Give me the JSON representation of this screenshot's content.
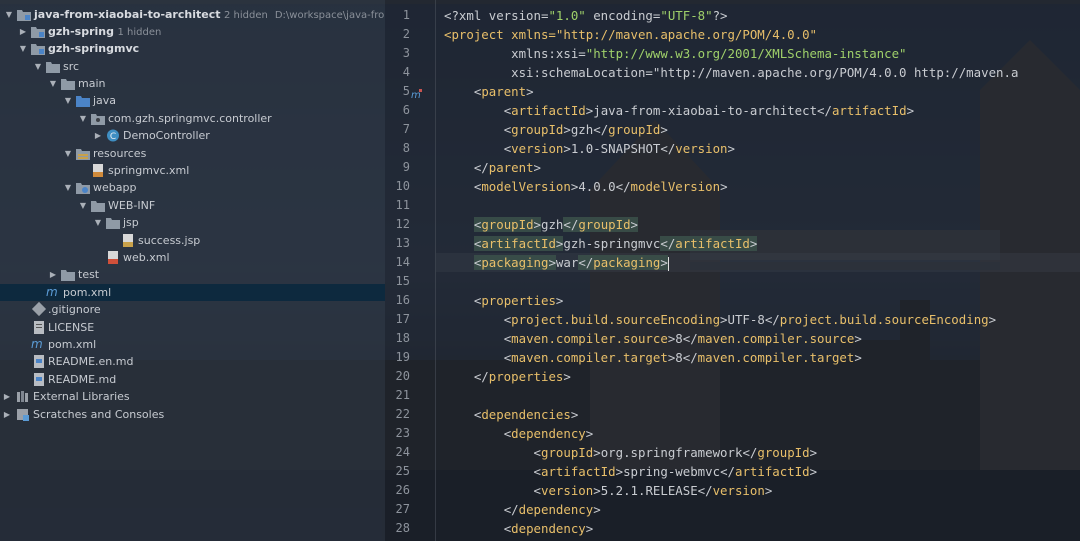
{
  "project_tree": {
    "items": [
      {
        "label": "java-from-xiaobai-to-architect",
        "hidden": "2 hidden",
        "path": "D:\\workspace\\java-from-xiaoba",
        "type": "module",
        "expanded": true
      },
      {
        "label": "gzh-spring",
        "hidden": "1 hidden",
        "type": "module",
        "expanded": false
      },
      {
        "label": "gzh-springmvc",
        "type": "module",
        "expanded": true
      },
      {
        "label": "src",
        "type": "folder",
        "expanded": true
      },
      {
        "label": "main",
        "type": "folder",
        "expanded": true
      },
      {
        "label": "java",
        "type": "source-folder",
        "expanded": true
      },
      {
        "label": "com.gzh.springmvc.controller",
        "type": "package",
        "expanded": true
      },
      {
        "label": "DemoController",
        "type": "class",
        "expanded": false
      },
      {
        "label": "resources",
        "type": "resources-folder",
        "expanded": true
      },
      {
        "label": "springmvc.xml",
        "type": "xml-file"
      },
      {
        "label": "webapp",
        "type": "web-folder",
        "expanded": true
      },
      {
        "label": "WEB-INF",
        "type": "folder",
        "expanded": true
      },
      {
        "label": "jsp",
        "type": "folder",
        "expanded": true
      },
      {
        "label": "success.jsp",
        "type": "jsp-file"
      },
      {
        "label": "web.xml",
        "type": "xml-file"
      },
      {
        "label": "test",
        "type": "folder",
        "expanded": false
      },
      {
        "label": "pom.xml",
        "type": "maven-file",
        "selected": true
      },
      {
        "label": ".gitignore",
        "type": "git-file"
      },
      {
        "label": "LICENSE",
        "type": "text-file"
      },
      {
        "label": "pom.xml",
        "type": "maven-file"
      },
      {
        "label": "README.en.md",
        "type": "md-file"
      },
      {
        "label": "README.md",
        "type": "md-file"
      },
      {
        "label": "External Libraries",
        "type": "libraries",
        "expanded": false
      },
      {
        "label": "Scratches and Consoles",
        "type": "scratches",
        "expanded": false
      }
    ]
  },
  "editor": {
    "file": "pom.xml",
    "lines": [
      {
        "n": "1",
        "code": "<?xml version=\"1.0\" encoding=\"UTF-8\"?>"
      },
      {
        "n": "2",
        "code": "<project xmlns=\"http://maven.apache.org/POM/4.0.0\""
      },
      {
        "n": "3",
        "code": "         xmlns:xsi=\"http://www.w3.org/2001/XMLSchema-instance\""
      },
      {
        "n": "4",
        "code": "         xsi:schemaLocation=\"http://maven.apache.org/POM/4.0.0 http://maven.a"
      },
      {
        "n": "5",
        "code": "    <parent>"
      },
      {
        "n": "6",
        "code": "        <artifactId>java-from-xiaobai-to-architect</artifactId>"
      },
      {
        "n": "7",
        "code": "        <groupId>gzh</groupId>"
      },
      {
        "n": "8",
        "code": "        <version>1.0-SNAPSHOT</version>"
      },
      {
        "n": "9",
        "code": "    </parent>"
      },
      {
        "n": "10",
        "code": "    <modelVersion>4.0.0</modelVersion>"
      },
      {
        "n": "11",
        "code": ""
      },
      {
        "n": "12",
        "code": "    <groupId>gzh</groupId>"
      },
      {
        "n": "13",
        "code": "    <artifactId>gzh-springmvc</artifactId>"
      },
      {
        "n": "14",
        "code": "    <packaging>war</packaging>"
      },
      {
        "n": "15",
        "code": ""
      },
      {
        "n": "16",
        "code": "    <properties>"
      },
      {
        "n": "17",
        "code": "        <project.build.sourceEncoding>UTF-8</project.build.sourceEncoding>"
      },
      {
        "n": "18",
        "code": "        <maven.compiler.source>8</maven.compiler.source>"
      },
      {
        "n": "19",
        "code": "        <maven.compiler.target>8</maven.compiler.target>"
      },
      {
        "n": "20",
        "code": "    </properties>"
      },
      {
        "n": "21",
        "code": ""
      },
      {
        "n": "22",
        "code": "    <dependencies>"
      },
      {
        "n": "23",
        "code": "        <dependency>"
      },
      {
        "n": "24",
        "code": "            <groupId>org.springframework</groupId>"
      },
      {
        "n": "25",
        "code": "            <artifactId>spring-webmvc</artifactId>"
      },
      {
        "n": "26",
        "code": "            <version>5.2.1.RELEASE</version>"
      },
      {
        "n": "27",
        "code": "        </dependency>"
      },
      {
        "n": "28",
        "code": "        <dependency>"
      }
    ],
    "current_line": "14",
    "highlighted_tag_lines": [
      "12",
      "13",
      "14"
    ]
  },
  "colors": {
    "tag": "#e8bf6a",
    "string": "#9fd06a",
    "text": "#c9ccd1",
    "line_number": "#8d939c",
    "selection": "#0d293e",
    "tag_highlight": "#3b514a"
  }
}
